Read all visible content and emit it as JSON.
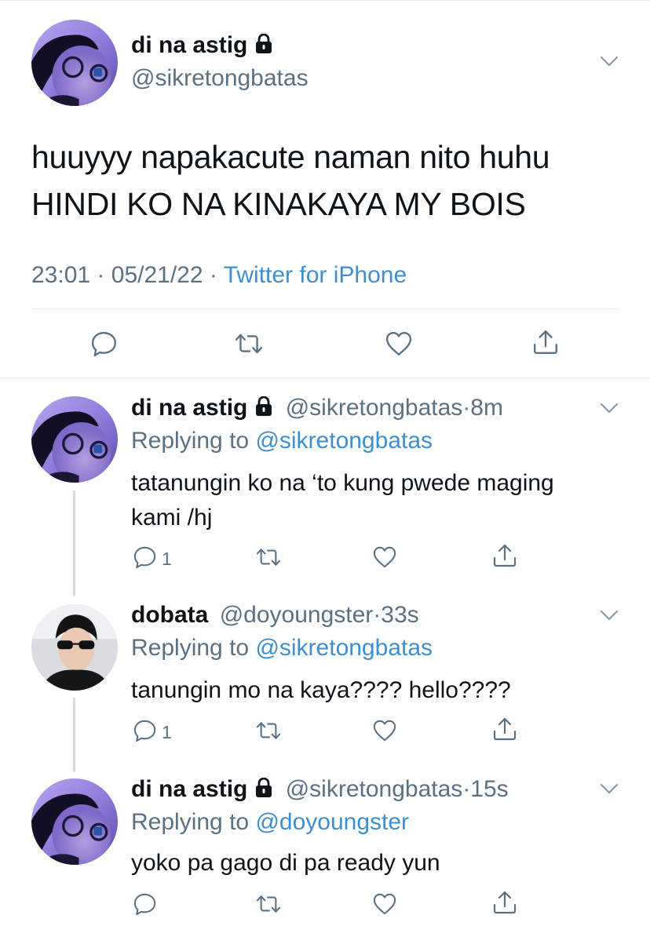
{
  "main_tweet": {
    "display_name": "di na astig",
    "handle": "@sikretongbatas",
    "text_line1": "huuyyy napakacute naman nito huhu",
    "text_line2": "HINDI KO NA KINAKAYA MY BOIS",
    "time": "23:01",
    "date": "05/21/22",
    "separator": "·",
    "client": "Twitter for iPhone",
    "icons": [
      "reply-icon",
      "retweet-icon",
      "like-icon",
      "share-icon"
    ],
    "locked": true
  },
  "replies": [
    {
      "display_name": "di na astig",
      "handle": "@sikretongbatas",
      "sep": "·",
      "age": "8m",
      "replying_prefix": "Replying to",
      "replying_to": "@sikretongbatas",
      "text_line1": "tatanungin ko na ‘to kung pwede maging",
      "text_line2": "kami /hj",
      "reply_count": "1",
      "locked": true
    },
    {
      "display_name": "dobata",
      "handle": "@doyoungster",
      "sep": "·",
      "age": "33s",
      "replying_prefix": "Replying to",
      "replying_to": "@sikretongbatas",
      "text_line1": "tanungin mo na kaya???? hello????",
      "reply_count": "1",
      "locked": false
    },
    {
      "display_name": "di na astig",
      "handle": "@sikretongbatas",
      "sep": "·",
      "age": "15s",
      "replying_prefix": "Replying to",
      "replying_to": "@doyoungster",
      "text_line1": "yoko pa gago di pa ready yun",
      "reply_count": "",
      "locked": true
    }
  ],
  "colors": {
    "text": "#0f1419",
    "secondary": "#5b7083",
    "link": "#3d8fd1",
    "divider": "#e1e6ea"
  }
}
